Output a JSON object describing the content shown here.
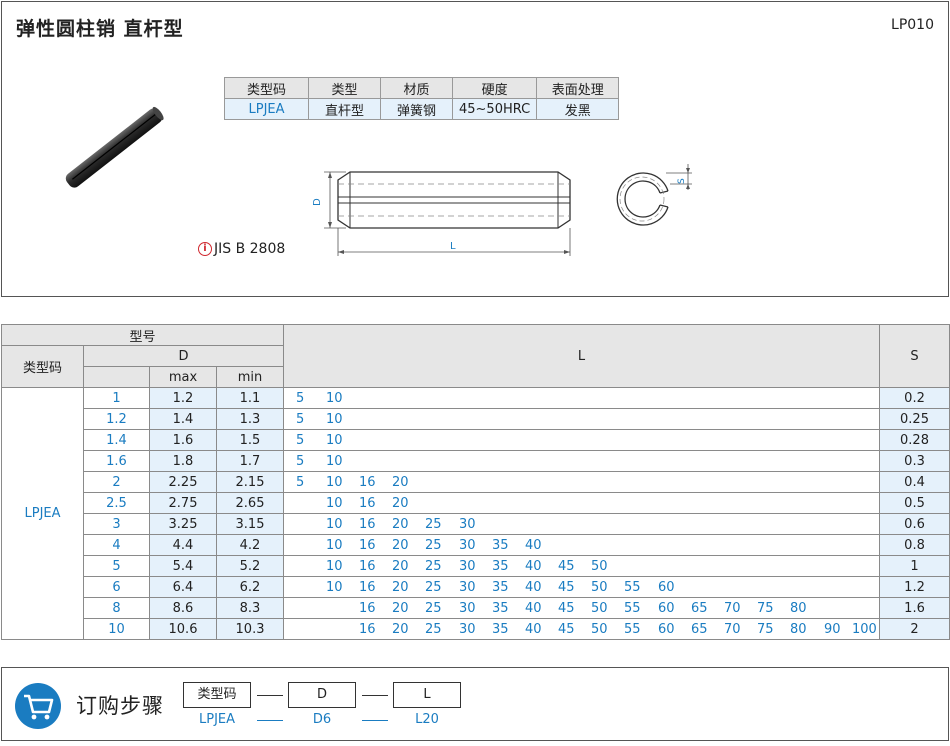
{
  "header": {
    "title": "弹性圆柱销   直杆型",
    "code": "LP010"
  },
  "spec_table": {
    "headers": [
      "类型码",
      "类型",
      "材质",
      "硬度",
      "表面处理"
    ],
    "values": [
      "LPJEA",
      "直杆型",
      "弹簧钢",
      "45~50HRC",
      "发黑"
    ]
  },
  "drawing": {
    "d_label": "D",
    "l_label": "L",
    "s_label": "S"
  },
  "standard": {
    "icon": "i",
    "text": "JIS  B  2808"
  },
  "main_table": {
    "h_model": "型号",
    "h_typecode": "类型码",
    "h_d": "D",
    "h_max": "max",
    "h_min": "min",
    "h_l": "L",
    "h_s": "S",
    "typecode": "LPJEA",
    "rows": [
      {
        "size": "1",
        "max": "1.2",
        "min": "1.1",
        "s": "0.2",
        "l": [
          "5",
          "10"
        ]
      },
      {
        "size": "1.2",
        "max": "1.4",
        "min": "1.3",
        "s": "0.25",
        "l": [
          "5",
          "10"
        ]
      },
      {
        "size": "1.4",
        "max": "1.6",
        "min": "1.5",
        "s": "0.28",
        "l": [
          "5",
          "10"
        ]
      },
      {
        "size": "1.6",
        "max": "1.8",
        "min": "1.7",
        "s": "0.3",
        "l": [
          "5",
          "10"
        ]
      },
      {
        "size": "2",
        "max": "2.25",
        "min": "2.15",
        "s": "0.4",
        "l": [
          "5",
          "10",
          "16",
          "20"
        ]
      },
      {
        "size": "2.5",
        "max": "2.75",
        "min": "2.65",
        "s": "0.5",
        "l": [
          "10",
          "16",
          "20"
        ]
      },
      {
        "size": "3",
        "max": "3.25",
        "min": "3.15",
        "s": "0.6",
        "l": [
          "10",
          "16",
          "20",
          "25",
          "30"
        ]
      },
      {
        "size": "4",
        "max": "4.4",
        "min": "4.2",
        "s": "0.8",
        "l": [
          "10",
          "16",
          "20",
          "25",
          "30",
          "35",
          "40"
        ]
      },
      {
        "size": "5",
        "max": "5.4",
        "min": "5.2",
        "s": "1",
        "l": [
          "10",
          "16",
          "20",
          "25",
          "30",
          "35",
          "40",
          "45",
          "50"
        ]
      },
      {
        "size": "6",
        "max": "6.4",
        "min": "6.2",
        "s": "1.2",
        "l": [
          "10",
          "16",
          "20",
          "25",
          "30",
          "35",
          "40",
          "45",
          "50",
          "55",
          "60"
        ]
      },
      {
        "size": "8",
        "max": "8.6",
        "min": "8.3",
        "s": "1.6",
        "l": [
          "16",
          "20",
          "25",
          "30",
          "35",
          "40",
          "45",
          "50",
          "55",
          "60",
          "65",
          "70",
          "75",
          "80"
        ]
      },
      {
        "size": "10",
        "max": "10.6",
        "min": "10.3",
        "s": "2",
        "l": [
          "16",
          "20",
          "25",
          "30",
          "35",
          "40",
          "45",
          "50",
          "55",
          "60",
          "65",
          "70",
          "75",
          "80",
          "90",
          "100"
        ]
      }
    ]
  },
  "order": {
    "title": "订购步骤",
    "fields": [
      "类型码",
      "D",
      "L"
    ],
    "examples": [
      "LPJEA",
      "D6",
      "L20"
    ],
    "icon": "cart-icon"
  },
  "colors": {
    "accent": "#1a7cc1",
    "header_bg": "#e6e6e6",
    "value_bg": "#e5f1fb"
  }
}
